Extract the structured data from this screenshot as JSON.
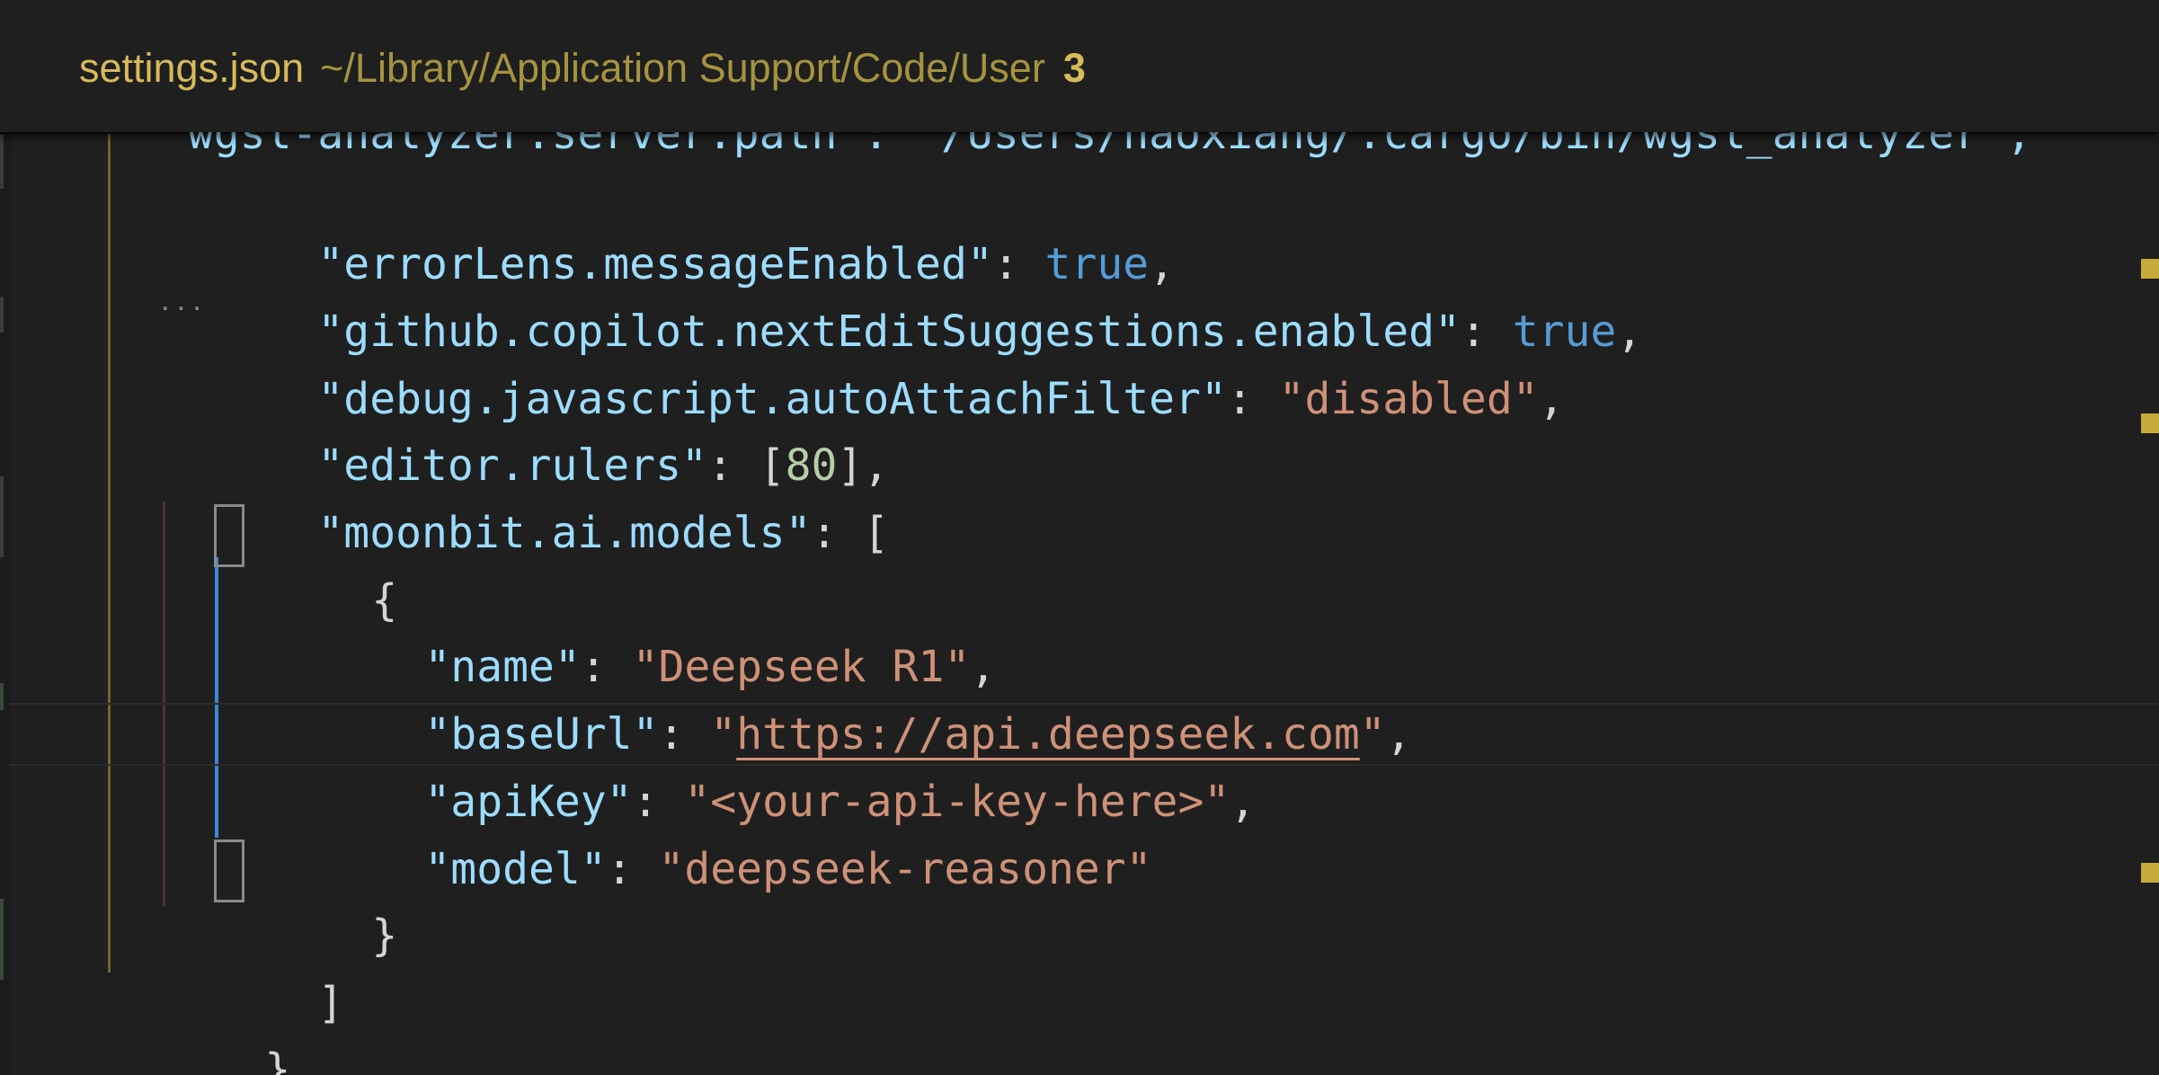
{
  "header": {
    "file_name": "settings.json",
    "file_path": "~/Library/Application Support/Code/User",
    "problem_count": "3"
  },
  "code": {
    "cut_line": "\"wgsl-analyzer.server.path\": \"/Users/haoxiang/.cargo/bin/wgsl_analyzer\",",
    "lines": [
      {
        "key": "\"errorLens.messageEnabled\"",
        "colon": ": ",
        "value": "true",
        "end": ","
      },
      {
        "key": "\"github.copilot.nextEditSuggestions.enabled\"",
        "colon": ": ",
        "value": "true",
        "end": ","
      },
      {
        "key": "\"debug.javascript.autoAttachFilter\"",
        "colon": ": ",
        "value": "\"disabled\"",
        "end": ","
      },
      {
        "key": "\"editor.rulers\"",
        "colon": ": ",
        "open": "[",
        "value": "80",
        "close": "]",
        "end": ","
      },
      {
        "key": "\"moonbit.ai.models\"",
        "colon": ": ",
        "value": "["
      },
      {
        "value": "{"
      },
      {
        "key": "\"name\"",
        "colon": ": ",
        "value": "\"Deepseek R1\"",
        "end": ","
      },
      {
        "key": "\"baseUrl\"",
        "colon": ": ",
        "quote_open": "\"",
        "value": "https://api.deepseek.com",
        "quote_close": "\"",
        "end": ","
      },
      {
        "key": "\"apiKey\"",
        "colon": ": ",
        "value": "\"<your-api-key-here>\"",
        "end": ","
      },
      {
        "key": "\"model\"",
        "colon": ": ",
        "value": "\"deepseek-reasoner\""
      },
      {
        "value": "}"
      },
      {
        "value": "]"
      },
      {
        "value": "}"
      }
    ],
    "hint_dots": "..."
  },
  "colors": {
    "background": "#1f1f1f",
    "key": "#9cdcfe",
    "string": "#ce9178",
    "boolean": "#569cd6",
    "number": "#b5cea8",
    "header_title": "#d7ba5a",
    "active_indent_guide": "#3b87d8"
  }
}
